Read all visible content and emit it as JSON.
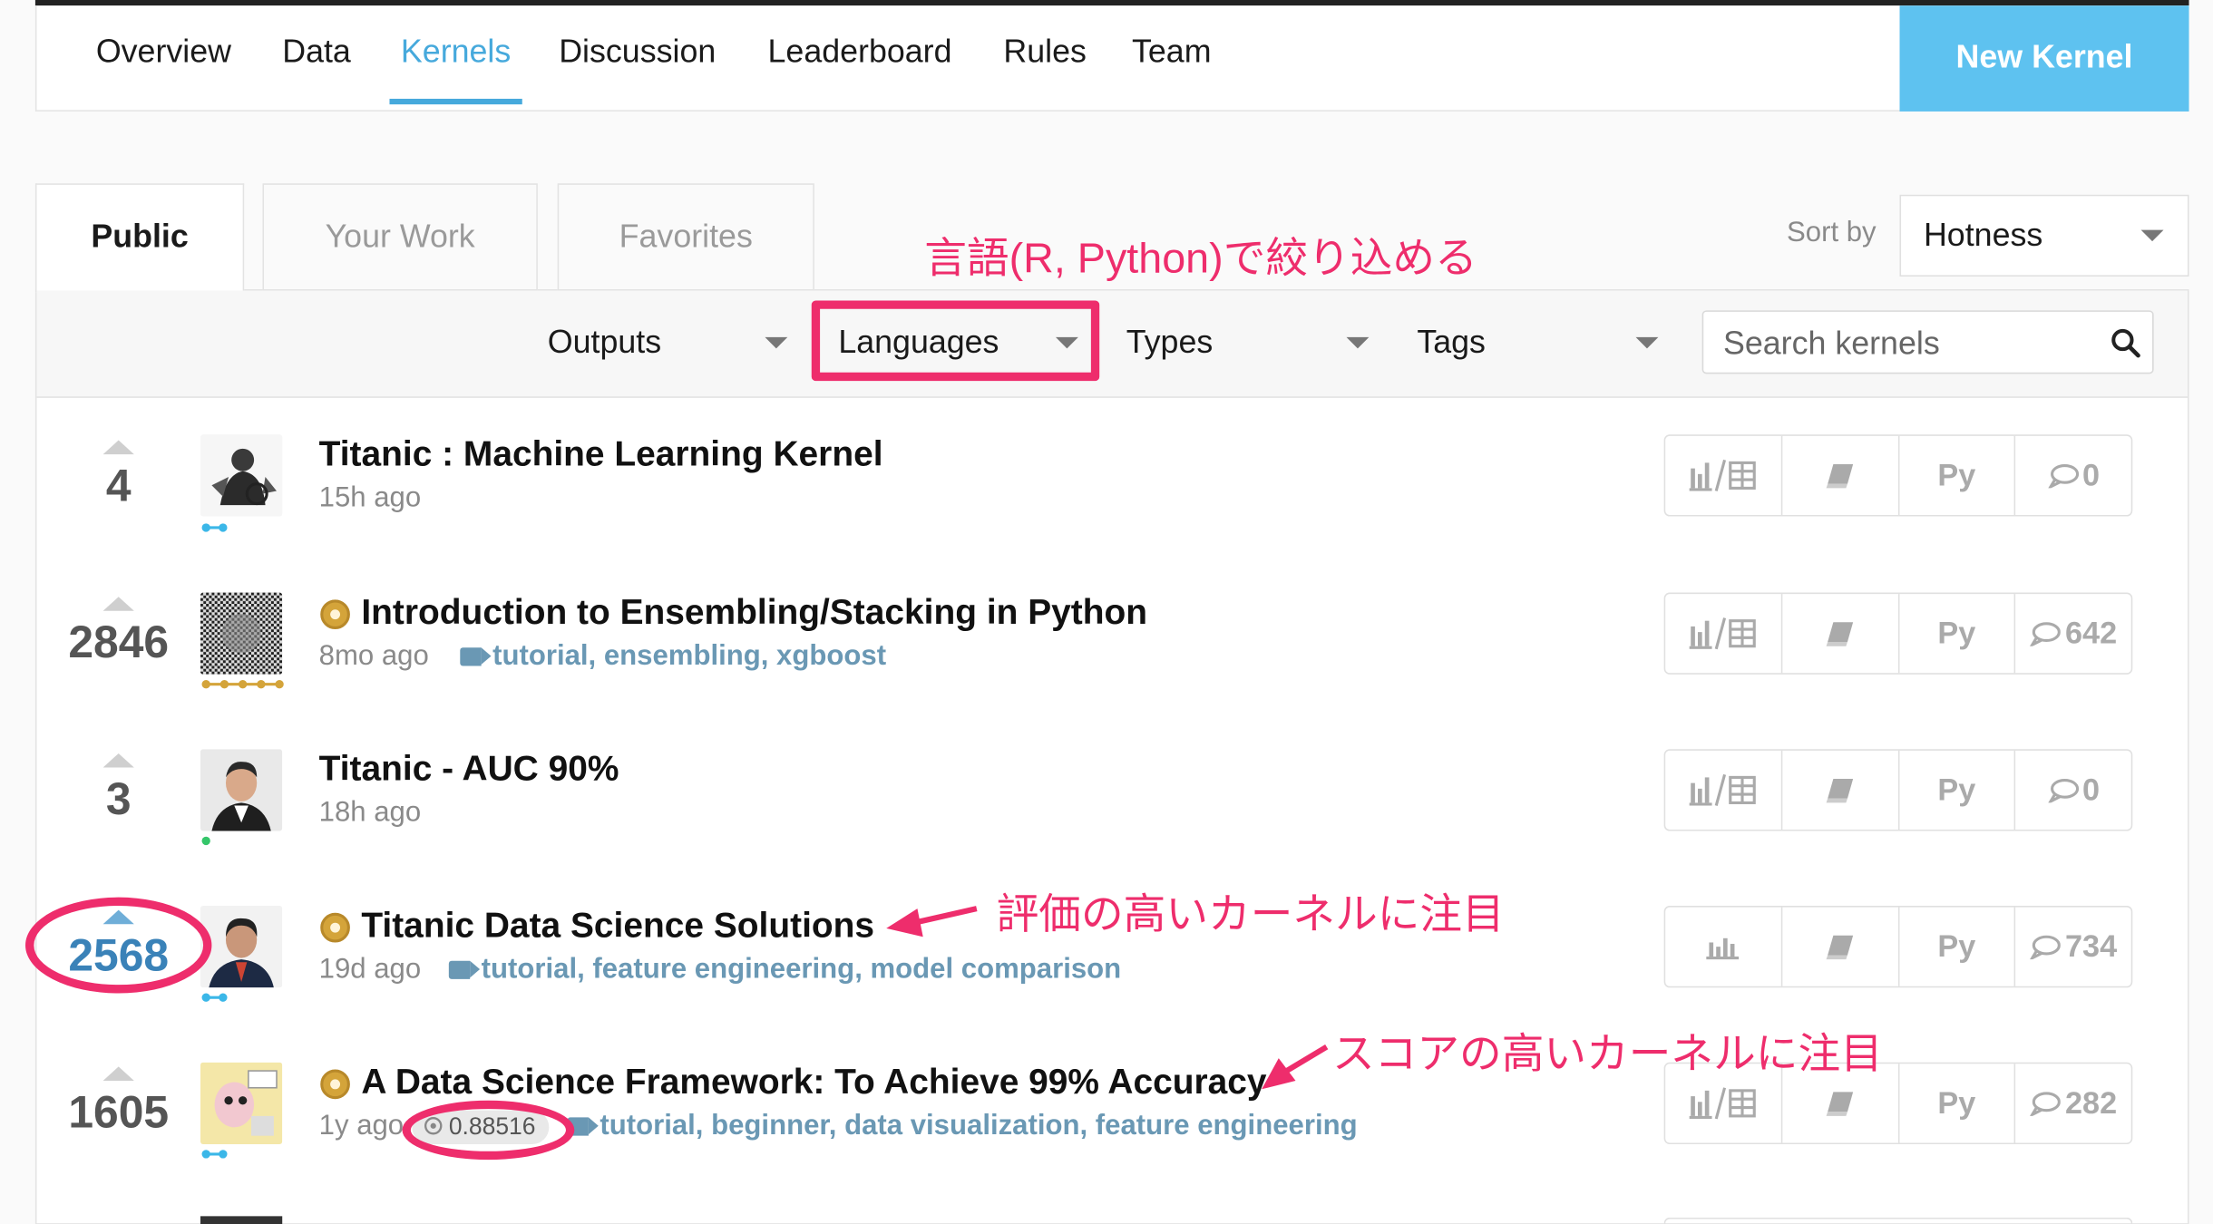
{
  "nav": {
    "items": [
      {
        "label": "Overview"
      },
      {
        "label": "Data"
      },
      {
        "label": "Kernels"
      },
      {
        "label": "Discussion"
      },
      {
        "label": "Leaderboard"
      },
      {
        "label": "Rules"
      },
      {
        "label": "Team"
      }
    ],
    "active": "Kernels",
    "new_kernel_label": "New Kernel"
  },
  "tabs": [
    {
      "label": "Public"
    },
    {
      "label": "Your Work"
    },
    {
      "label": "Favorites"
    }
  ],
  "sort": {
    "label": "Sort by",
    "value": "Hotness"
  },
  "filters": {
    "outputs": "Outputs",
    "languages": "Languages",
    "types": "Types",
    "tags": "Tags",
    "search_placeholder": "Search kernels"
  },
  "annotations": {
    "languages_note": "言語(R, Python)で絞り込める",
    "votes_note": "評価の高いカーネルに注目",
    "score_note": "スコアの高いカーネルに注目"
  },
  "kernels": [
    {
      "votes": "4",
      "title": "Titanic : Machine Learning Kernel",
      "age": "15h ago",
      "tags": "",
      "score": "",
      "lang": "Py",
      "comments": "0",
      "medal": false
    },
    {
      "votes": "2846",
      "title": "Introduction to Ensembling/Stacking in Python",
      "age": "8mo ago",
      "tags": "tutorial, ensembling, xgboost",
      "score": "",
      "lang": "Py",
      "comments": "642",
      "medal": true
    },
    {
      "votes": "3",
      "title": "Titanic - AUC 90%",
      "age": "18h ago",
      "tags": "",
      "score": "",
      "lang": "Py",
      "comments": "0",
      "medal": false
    },
    {
      "votes": "2568",
      "title": "Titanic Data Science Solutions",
      "age": "19d ago",
      "tags": "tutorial, feature engineering, model comparison",
      "score": "",
      "lang": "Py",
      "comments": "734",
      "medal": true
    },
    {
      "votes": "1605",
      "title": "A Data Science Framework: To Achieve 99% Accuracy",
      "age": "1y ago",
      "tags": "tutorial, beginner, data visualization, feature engineering",
      "score": "0.88516",
      "lang": "Py",
      "comments": "282",
      "medal": true
    }
  ],
  "colors": {
    "accent": "#46a9dc",
    "new_button": "#5ec2f0",
    "annotation": "#ee2d6c",
    "tag": "#6a98b4"
  }
}
